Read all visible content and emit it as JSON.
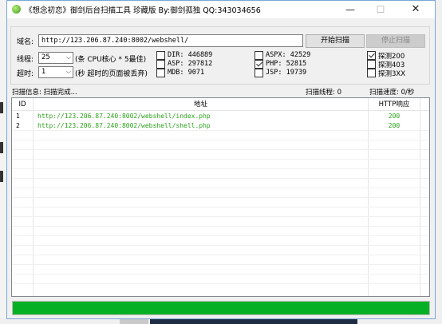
{
  "window": {
    "title": "《想念初恋》御剑后台扫描工具 珍藏版 By:御剑孤独 QQ:343034656",
    "min_glyph": "—",
    "max_glyph": "☐",
    "close_glyph": "✕"
  },
  "form": {
    "url_label": "域名:",
    "url_value": "http://123.206.87.240:8002/webshell/",
    "start_button": "开始扫描",
    "stop_button": "停止扫描",
    "threads_label": "线程:",
    "threads_value": "25",
    "threads_hint": "(条 CPU核心 * 5最佳)",
    "timeout_label": "超时:",
    "timeout_value": "1",
    "timeout_hint": "(秒 超时的页面被丢弃)"
  },
  "dictionaries": [
    {
      "label": "DIR: 446889",
      "checked": false
    },
    {
      "label": "ASP: 297812",
      "checked": false
    },
    {
      "label": "MDB: 9071",
      "checked": false
    },
    {
      "label": "ASPX: 42529",
      "checked": false
    },
    {
      "label": "PHP: 52815",
      "checked": true
    },
    {
      "label": "JSP: 19739",
      "checked": false
    }
  ],
  "probe_options": [
    {
      "label": "探测200",
      "checked": true
    },
    {
      "label": "探测403",
      "checked": false
    },
    {
      "label": "探测3XX",
      "checked": false
    }
  ],
  "status": {
    "info": "扫描信息: 扫描完成...",
    "threads": "扫描线程: 0",
    "speed": "扫描速度: 0/秒"
  },
  "table": {
    "columns": [
      "ID",
      "地址",
      "HTTP响应"
    ],
    "rows": [
      {
        "id": "1",
        "url": "http://123.206.87.240:8002/webshell/index.php",
        "code": "200"
      },
      {
        "id": "2",
        "url": "http://123.206.87.240:8002/webshell/shell.php",
        "code": "200"
      }
    ]
  },
  "progress": {
    "value": 1.0
  },
  "colors": {
    "progress": "#06b025",
    "result_text": "#2aa21a",
    "window_border": "#7aa7d8"
  }
}
